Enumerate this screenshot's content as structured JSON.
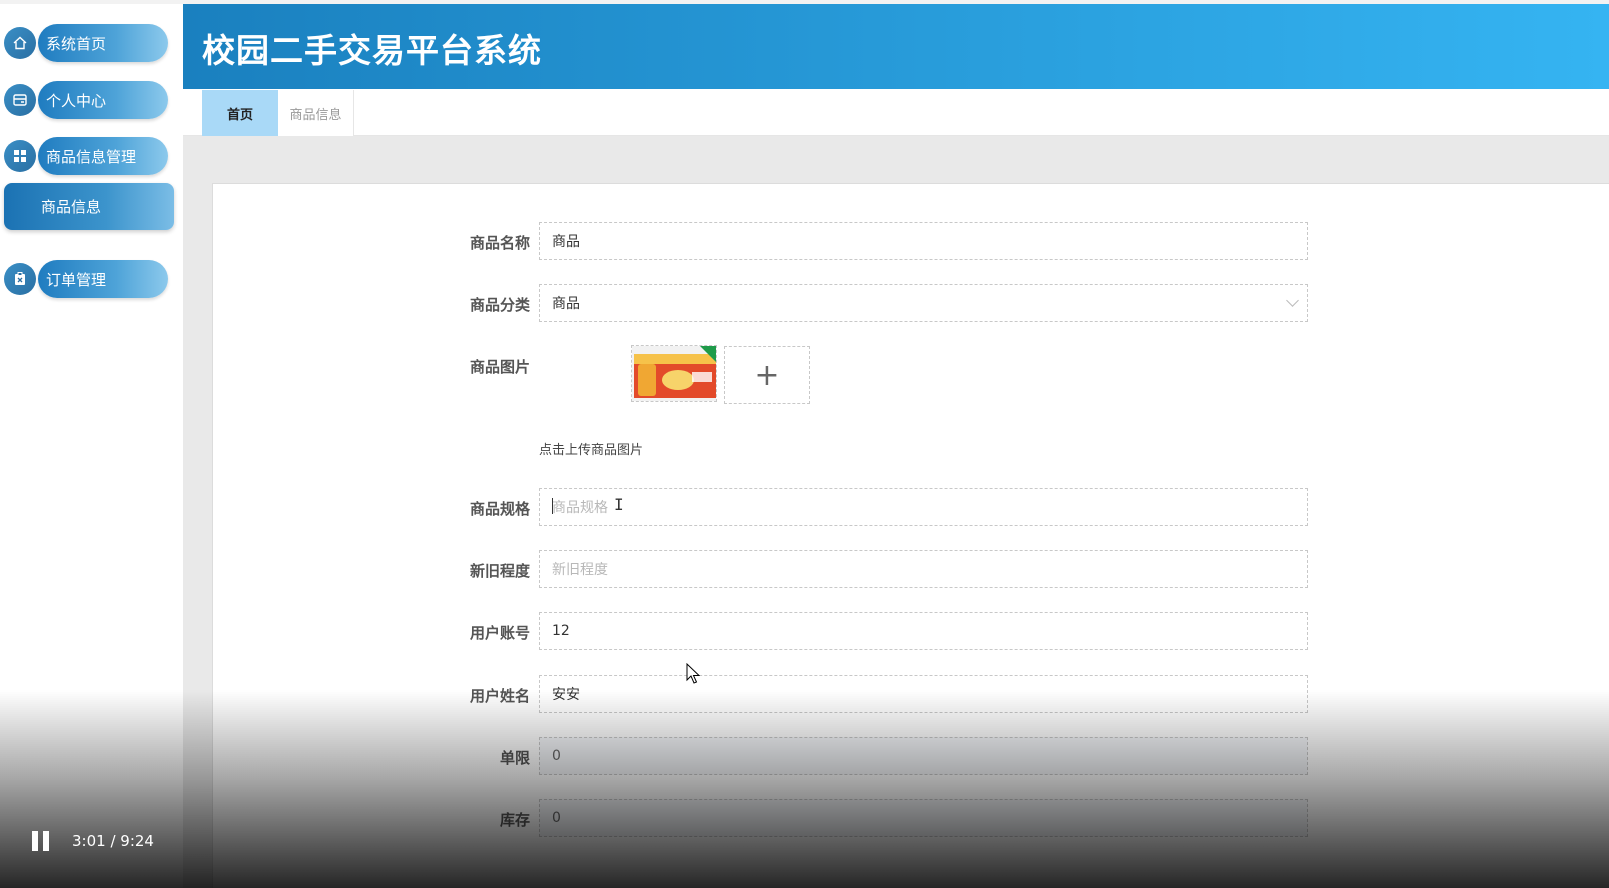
{
  "app": {
    "title": "校园二手交易平台系统"
  },
  "sidebar": {
    "items": [
      {
        "label": "系统首页",
        "icon": "home-icon"
      },
      {
        "label": "个人中心",
        "icon": "profile-card-icon"
      },
      {
        "label": "商品信息管理",
        "icon": "grid-icon"
      },
      {
        "label": "订单管理",
        "icon": "clipboard-icon"
      }
    ],
    "sub_item": {
      "label": "商品信息"
    }
  },
  "tabs": [
    {
      "label": "首页",
      "active": true
    },
    {
      "label": "商品信息",
      "active": false
    }
  ],
  "form": {
    "fields": [
      {
        "label": "商品名称",
        "value": "商品",
        "placeholder": ""
      },
      {
        "label": "商品分类",
        "value": "商品",
        "type": "select"
      },
      {
        "label": "商品图片",
        "type": "image-upload"
      },
      {
        "label": "商品规格",
        "value": "",
        "placeholder": "商品规格"
      },
      {
        "label": "新旧程度",
        "value": "",
        "placeholder": "新旧程度"
      },
      {
        "label": "用户账号",
        "value": "12"
      },
      {
        "label": "用户姓名",
        "value": "安安"
      },
      {
        "label": "单限",
        "value": "0"
      },
      {
        "label": "库存",
        "value": "0"
      }
    ],
    "upload_hint": "点击上传商品图片",
    "upload_plus": "+"
  },
  "video": {
    "time": "3:01 / 9:24",
    "state": "playing"
  },
  "colors": {
    "header_start": "#1a80bf",
    "header_end": "#35b4f2",
    "active_tab": "#a9d9f7"
  }
}
